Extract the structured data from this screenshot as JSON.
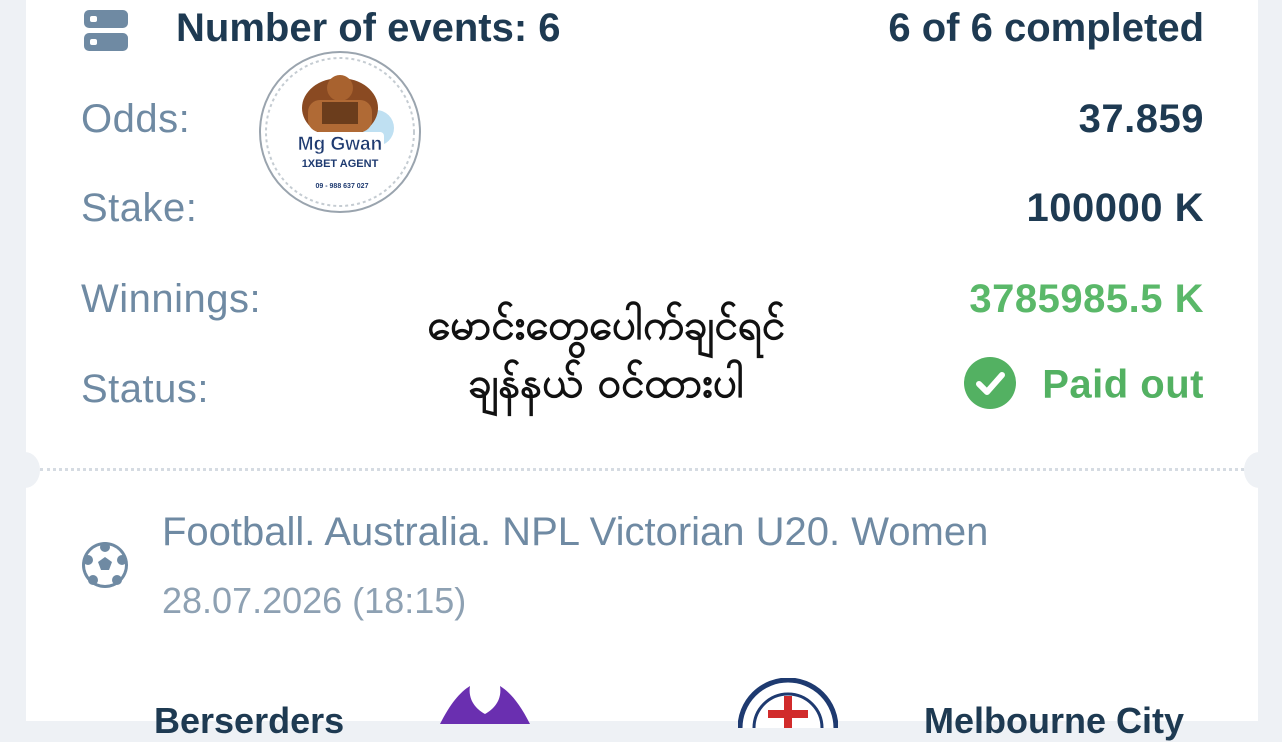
{
  "summary": {
    "events_label": "Number of events: 6",
    "events_completed": "6 of 6 completed",
    "odds_label": "Odds:",
    "odds_value": "37.859",
    "stake_label": "Stake:",
    "stake_value": "100000 K",
    "winnings_label": "Winnings:",
    "winnings_value": "3785985.5 K",
    "status_label": "Status:",
    "status_value": "Paid out"
  },
  "watermark": {
    "line1": "Mg Gwan",
    "line2": "1XBET AGENT",
    "phone": "09 - 988 637 027"
  },
  "overlay_text": {
    "line1": "မောင်းတွေပေါက်ချင်ရင်",
    "line2": "ချန်နယ် ဝင်ထားပါ"
  },
  "event": {
    "league": "Football. Australia. NPL Victorian U20. Women",
    "datetime": "28.07.2026 (18:15)",
    "home_team": "Berserders",
    "away_team": "Melbourne City"
  },
  "colors": {
    "accent_text": "#1e3a52",
    "label_text": "#6f8aa3",
    "win_green": "#5ab869"
  }
}
